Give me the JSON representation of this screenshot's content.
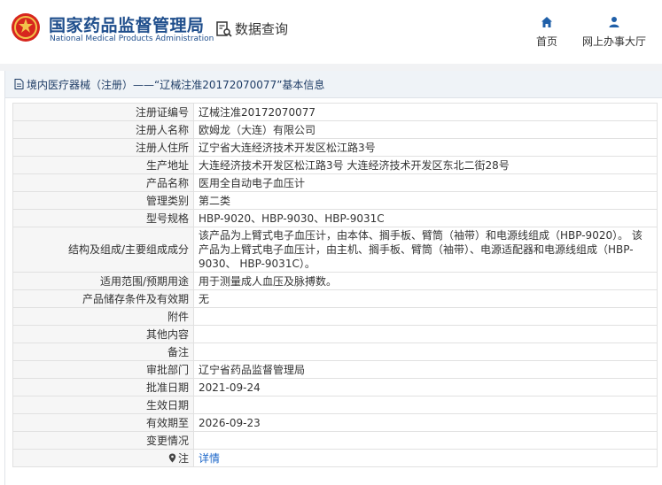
{
  "header": {
    "brand_cn": "国家药品监督管理局",
    "brand_en": "National Medical Products Administration",
    "query_label": "数据查询",
    "nav": [
      {
        "label": "首页",
        "icon": "home-icon"
      },
      {
        "label": "网上办事大厅",
        "icon": "person-icon"
      }
    ]
  },
  "breadcrumb": "境内医疗器械（注册）——“辽械注准20172070077”基本信息",
  "rows": [
    {
      "label": "注册证编号",
      "value": "辽械注准20172070077"
    },
    {
      "label": "注册人名称",
      "value": "欧姆龙（大连）有限公司"
    },
    {
      "label": "注册人住所",
      "value": "辽宁省大连经济技术开发区松江路3号"
    },
    {
      "label": "生产地址",
      "value": "大连经济技术开发区松江路3号 大连经济技术开发区东北二街28号"
    },
    {
      "label": "产品名称",
      "value": "医用全自动电子血压计"
    },
    {
      "label": "管理类别",
      "value": "第二类"
    },
    {
      "label": "型号规格",
      "value": "HBP-9020、HBP-9030、HBP-9031C"
    },
    {
      "label": "结构及组成/主要组成成分",
      "value": "该产品为上臂式电子血压计，由本体、搁手板、臂筒（袖带）和电源线组成（HBP-9020）。 该产品为上臂式电子血压计，由主机、搁手板、臂筒（袖带）、电源适配器和电源线组成（HBP-9030、 HBP-9031C）。"
    },
    {
      "label": "适用范围/预期用途",
      "value": "用于测量成人血压及脉搏数。"
    },
    {
      "label": "产品储存条件及有效期",
      "value": "无"
    },
    {
      "label": "附件",
      "value": ""
    },
    {
      "label": "其他内容",
      "value": ""
    },
    {
      "label": "备注",
      "value": ""
    },
    {
      "label": "审批部门",
      "value": "辽宁省药品监督管理局"
    },
    {
      "label": "批准日期",
      "value": "2021-09-24"
    },
    {
      "label": "生效日期",
      "value": ""
    },
    {
      "label": "有效期至",
      "value": "2026-09-23"
    },
    {
      "label": "变更情况",
      "value": ""
    },
    {
      "label": "注",
      "value": "详情",
      "icon": "pin-icon"
    }
  ]
}
